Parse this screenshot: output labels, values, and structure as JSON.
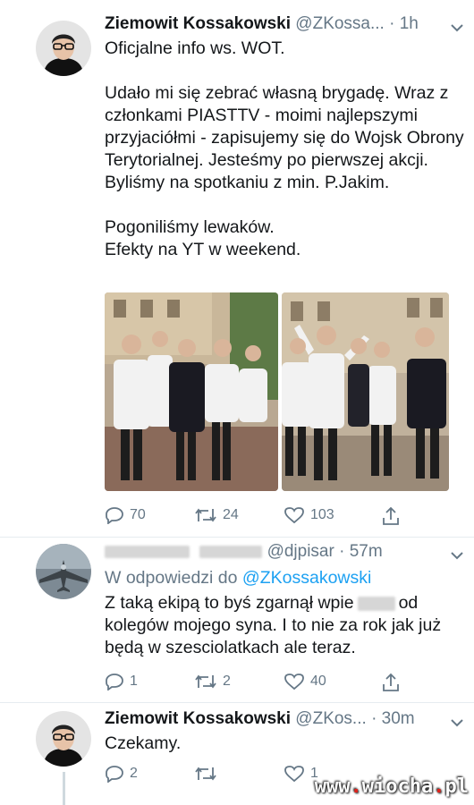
{
  "tweet1": {
    "name": "Ziemowit Kossakowski",
    "handle": "@ZKossa...",
    "time": "· 1h",
    "paragraphs": [
      "Oficjalne info ws. WOT.",
      "Udało mi się zebrać własną brygadę. Wraz z członkami PIASTTV - moimi najlepszymi przyjaciółmi - zapisujemy się do Wojsk Obrony Terytorialnej. Jesteśmy po pierwszej akcji. Byliśmy na spotkaniu z min. P.Jakim.",
      "Pogoniliśmy lewaków.\nEfekty na YT w weekend."
    ],
    "replies": "70",
    "retweets": "24",
    "likes": "103"
  },
  "tweet2": {
    "handle": "@djpisar",
    "time": "· 57m",
    "reply_prefix": "W odpowiedzi do ",
    "reply_to": "@ZKossakowski",
    "text_a": "Z taką ekipą to byś zgarnął wpie",
    "text_b": "od kolegów mojego syna. I to nie za rok jak już będą w szesciolatkach ale teraz.",
    "replies": "1",
    "retweets": "2",
    "likes": "40"
  },
  "tweet3": {
    "name": "Ziemowit Kossakowski",
    "handle": "@ZKos...",
    "time": "· 30m",
    "text": "Czekamy.",
    "replies": "2",
    "likes": "1"
  },
  "watermark": {
    "a": "www",
    "b": "wiocha",
    "c": "pl"
  },
  "colors": {
    "link": "#1da1f2",
    "muted": "#657786",
    "line": "#cfd9de"
  }
}
